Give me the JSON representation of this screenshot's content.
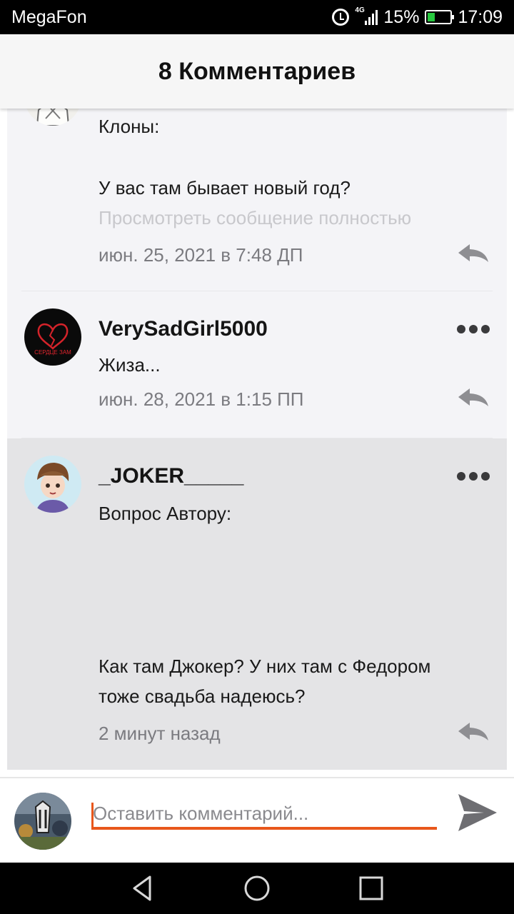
{
  "status_bar": {
    "carrier": "MegaFon",
    "network": "4G",
    "battery": "15%",
    "time": "17:09"
  },
  "header": {
    "title": "8 Комментариев"
  },
  "comments": [
    {
      "username": "",
      "lines": [
        "Клоны:",
        "У вас там бывает новый год?"
      ],
      "more_label": "Просмотреть сообщение полностью",
      "timestamp": "июн. 25, 2021 в 7:48 ДП"
    },
    {
      "username": "VerySadGirl5000",
      "avatar_caption": "СЕРДЦЕ ЗАМ",
      "lines": [
        "Жиза..."
      ],
      "timestamp": "июн. 28, 2021 в 1:15 ПП"
    },
    {
      "username": "_JOKER_____",
      "lines": [
        "Вопрос Автору:",
        "Как там Джокер? У них там с Федором",
        "тоже свадьба надеюсь?"
      ],
      "timestamp": "2 минут назад"
    }
  ],
  "compose": {
    "placeholder": "Оставить комментарий..."
  },
  "colors": {
    "accent": "#e8571b",
    "highlighted_comment_bg": "#e4e4e6",
    "comment_bg": "#f4f4f7"
  },
  "icons": {
    "reply": "reply-icon",
    "more": "more-options-icon",
    "send": "send-icon",
    "nav_back": "back-icon",
    "nav_home": "home-icon",
    "nav_recents": "recents-icon"
  }
}
